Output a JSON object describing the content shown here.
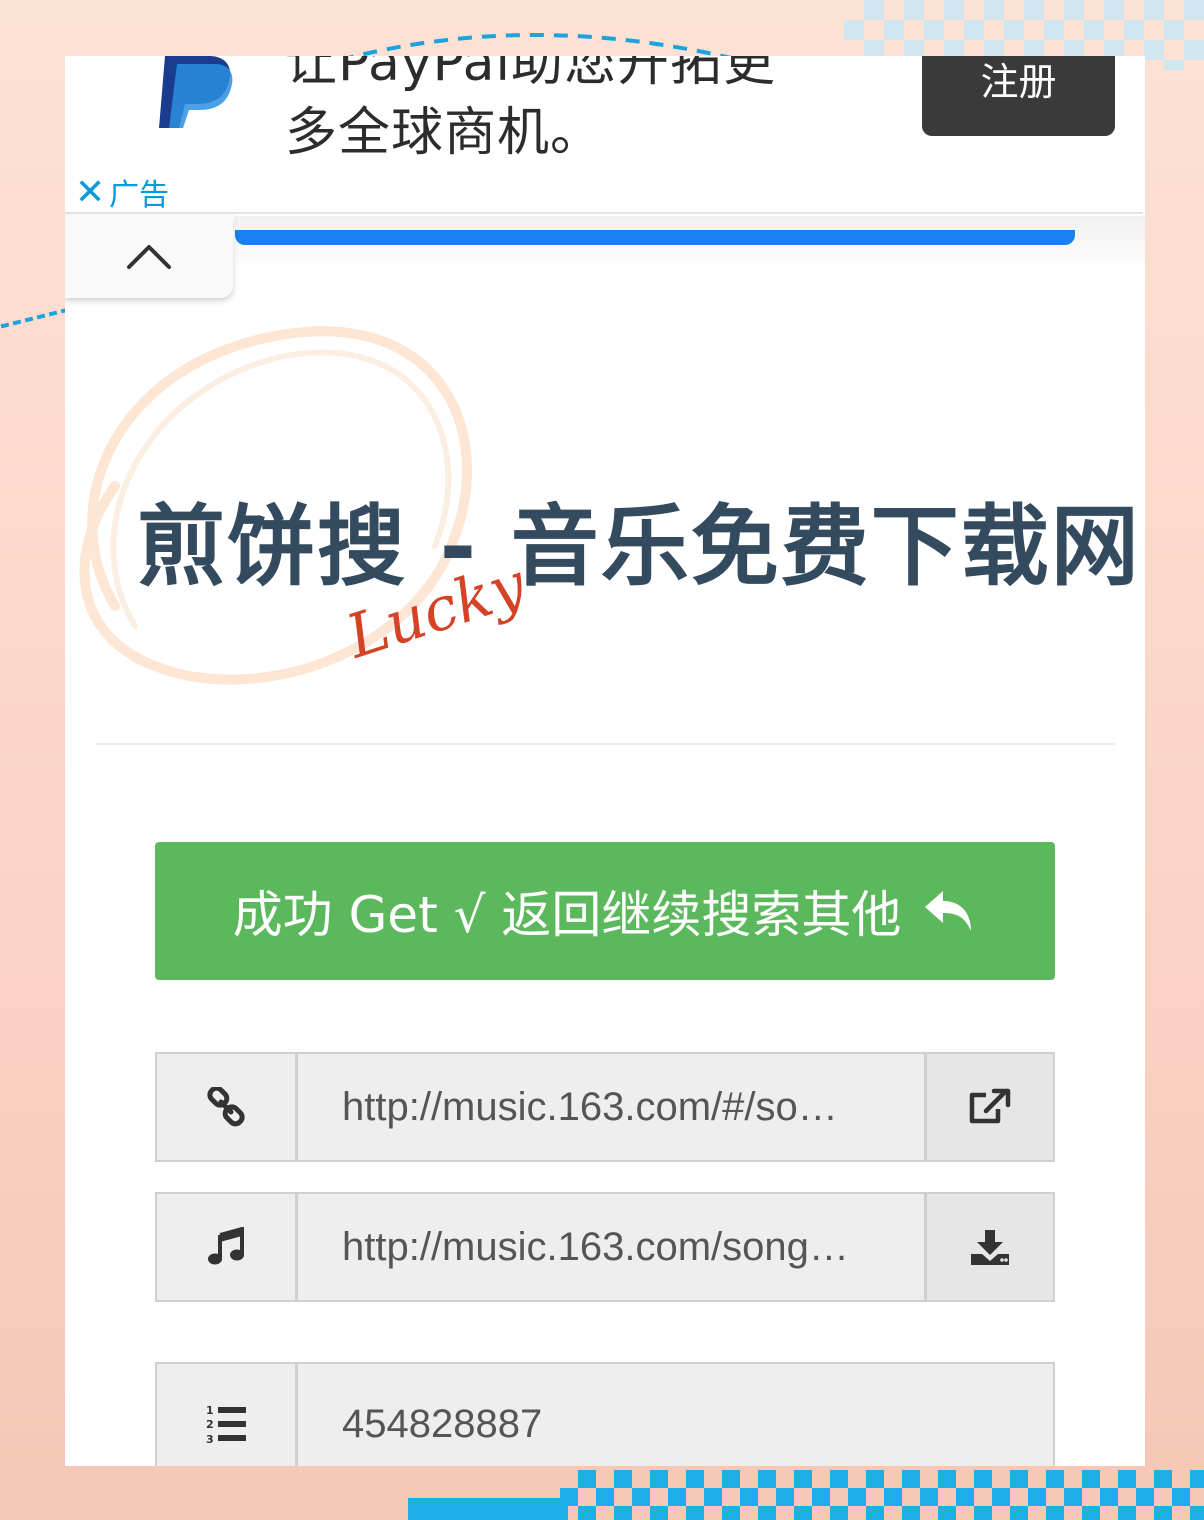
{
  "ad": {
    "headline_line1": "让PayPal助您开拓更",
    "headline_line2": "多全球商机。",
    "cta_label": "注册",
    "ad_label": "广告",
    "close_symbol": "✕",
    "logo_icon": "paypal-logo"
  },
  "header": {
    "collapse_icon": "chevron-up-icon",
    "progress_color": "#1a7ff0"
  },
  "site": {
    "title": "煎饼搜 - 音乐免费下载网",
    "lucky_script": "Lucky",
    "title_color": "#344a5e"
  },
  "result": {
    "success_button_label": "成功 Get √ 返回继续搜索其他",
    "success_icon": "reply-icon",
    "success_color": "#5cb85c"
  },
  "fields": [
    {
      "icon": "link-icon",
      "value": "http://music.163.com/#/so…",
      "action_icon": "external-link-icon"
    },
    {
      "icon": "music-note-icon",
      "value": "http://music.163.com/song…",
      "action_icon": "download-icon"
    },
    {
      "icon": "ordered-list-icon",
      "value": "454828887"
    }
  ]
}
